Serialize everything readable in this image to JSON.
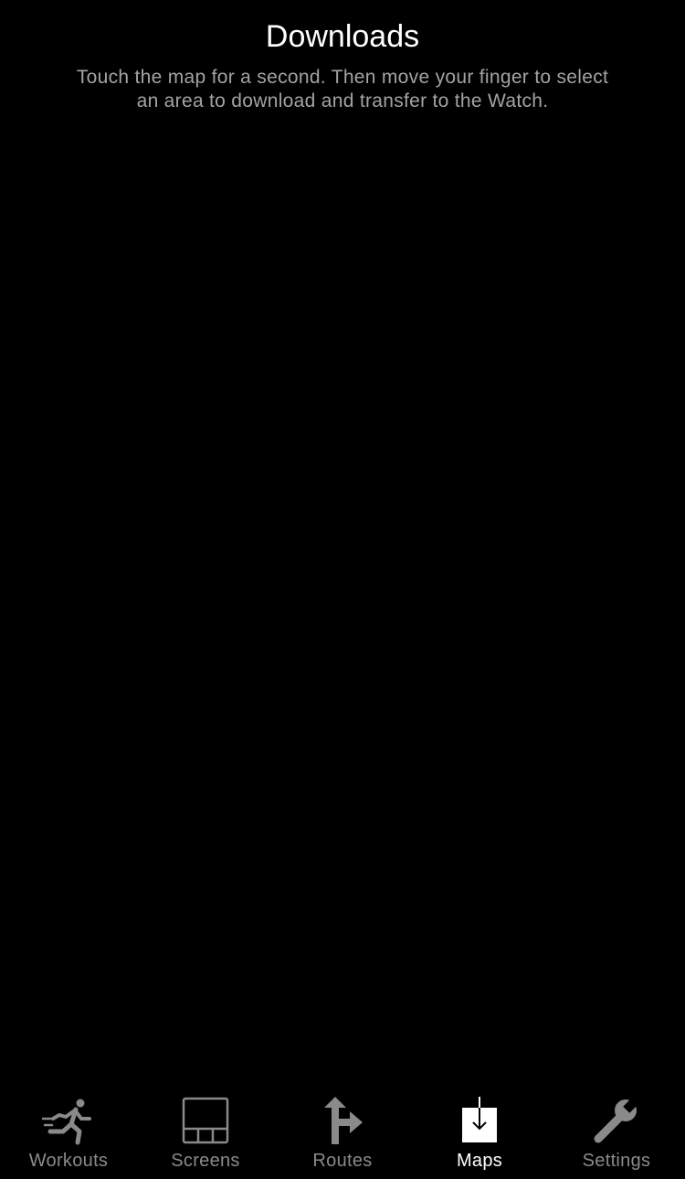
{
  "header": {
    "title": "Downloads",
    "subtitle": "Touch the map for a second. Then move your finger to select an area to download and transfer to the Watch."
  },
  "tabbar": {
    "active_tab": "Maps",
    "colors": {
      "inactive": "#8a8a8a",
      "active": "#ffffff"
    },
    "tabs": [
      {
        "label": "Workouts",
        "icon": "running-person-icon"
      },
      {
        "label": "Screens",
        "icon": "screen-layout-icon"
      },
      {
        "label": "Routes",
        "icon": "route-turn-icon"
      },
      {
        "label": "Maps",
        "icon": "download-icon"
      },
      {
        "label": "Settings",
        "icon": "wrench-icon"
      }
    ]
  }
}
